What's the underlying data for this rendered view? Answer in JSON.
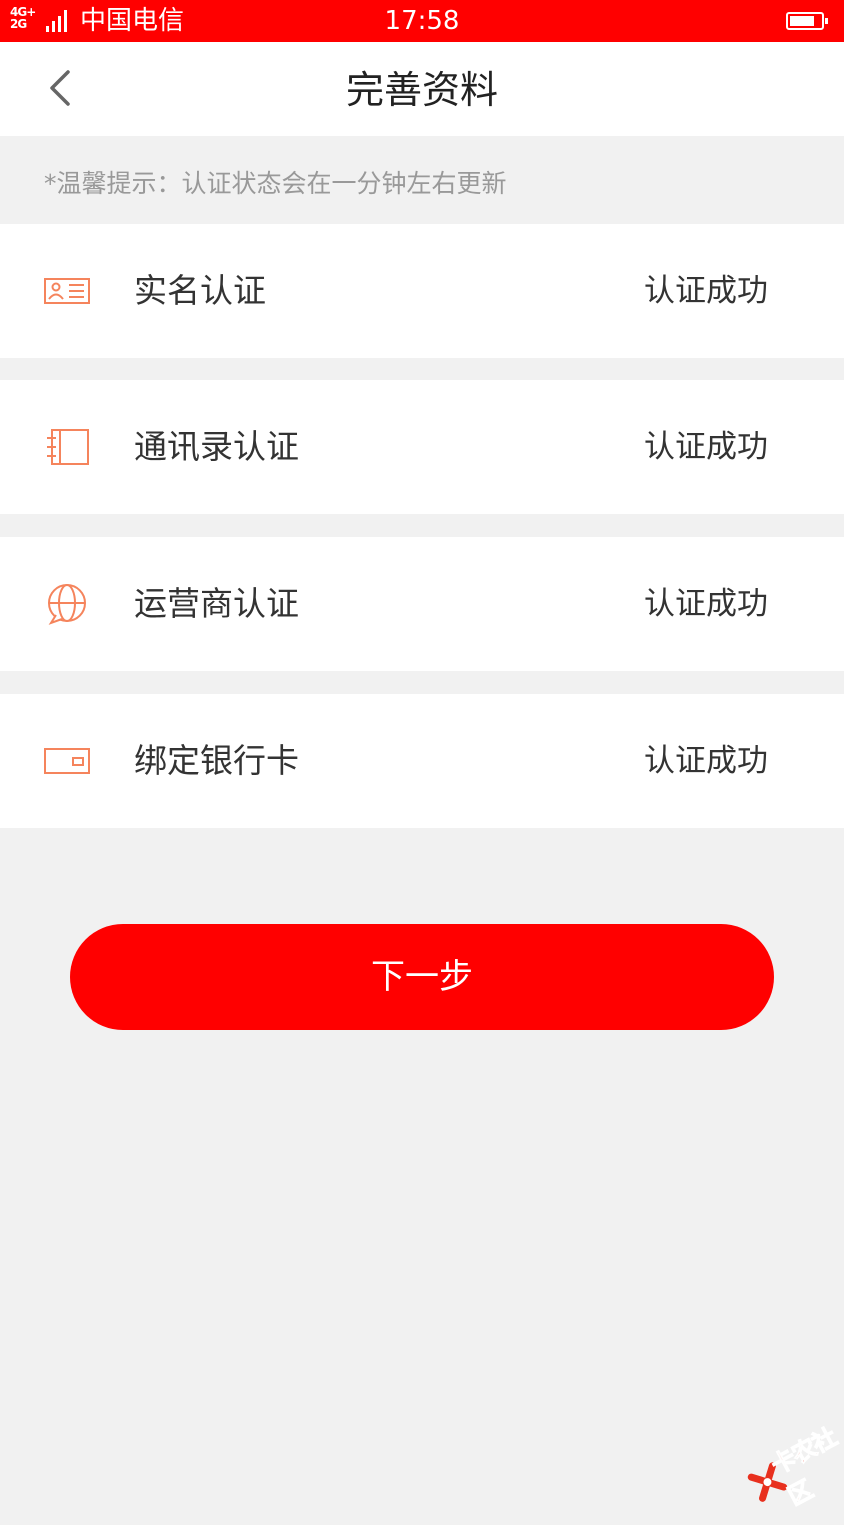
{
  "status_bar": {
    "network": "4G+\n2G",
    "carrier": "中国电信",
    "time": "17:58",
    "battery_level": 0.8
  },
  "nav": {
    "title": "完善资料",
    "back_icon": "chevron-left-icon"
  },
  "tip": "*温馨提示：认证状态会在一分钟左右更新",
  "cert_items": [
    {
      "label": "实名认证",
      "status": "认证成功",
      "icon": "id-card-icon"
    },
    {
      "label": "通讯录认证",
      "status": "认证成功",
      "icon": "contacts-book-icon"
    },
    {
      "label": "运营商认证",
      "status": "认证成功",
      "icon": "globe-phone-icon"
    },
    {
      "label": "绑定银行卡",
      "status": "认证成功",
      "icon": "bank-card-icon"
    }
  ],
  "next_button": "下一步",
  "watermark": {
    "text": "卡农社区",
    "icon": "kanong-logo-icon"
  },
  "colors": {
    "brand_red": "#ff0000",
    "icon_orange": "#f5845c",
    "background": "#f1f1f1",
    "text_primary": "#333333",
    "text_hint": "#999999"
  }
}
